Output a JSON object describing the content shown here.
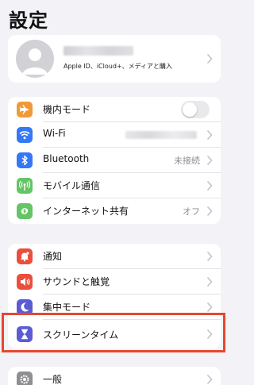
{
  "header": {
    "title": "設定"
  },
  "profile": {
    "subtitle": "Apple ID、iCloud+、メディアと購入"
  },
  "connectivity": {
    "items": [
      {
        "label": "機内モード",
        "icon": "airplane-icon",
        "color": "#f09a37"
      },
      {
        "label": "Wi-Fi",
        "icon": "wifi-icon",
        "color": "#3478f6"
      },
      {
        "label": "Bluetooth",
        "value": "未接続",
        "icon": "bluetooth-icon",
        "color": "#3478f6"
      },
      {
        "label": "モバイル通信",
        "icon": "antenna-icon",
        "color": "#65c466"
      },
      {
        "label": "インターネット共有",
        "value": "オフ",
        "icon": "link-icon",
        "color": "#65c466"
      }
    ]
  },
  "notifications": {
    "items": [
      {
        "label": "通知",
        "icon": "bell-icon",
        "color": "#eb4e3d"
      },
      {
        "label": "サウンドと触覚",
        "icon": "speaker-icon",
        "color": "#eb4e3d"
      },
      {
        "label": "集中モード",
        "icon": "moon-icon",
        "color": "#5b5bd6"
      },
      {
        "label": "スクリーンタイム",
        "icon": "hourglass-icon",
        "color": "#5b5bd6"
      }
    ]
  },
  "general": {
    "items": [
      {
        "label": "一般",
        "icon": "gear-icon",
        "color": "#8e8e93"
      }
    ]
  },
  "colors": {
    "highlight": "#e5482f",
    "background": "#f2f2f7"
  }
}
